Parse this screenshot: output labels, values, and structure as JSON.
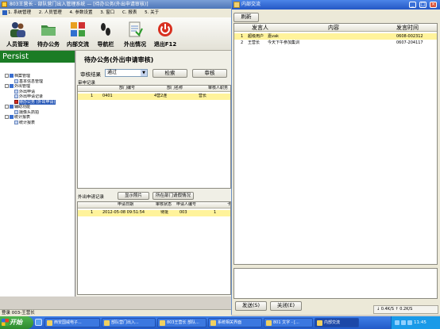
{
  "app": {
    "title": "803王营长 - 部队营门出入管理系统 — [待办公务(外出申请审核)]",
    "menu": [
      "1. 系统管理",
      "2. 人员管理",
      "4. 参数设置",
      "3. 窗口",
      "C. 报表",
      "5. 关于"
    ]
  },
  "toolbar": [
    {
      "label": "人员管理",
      "icon": "people-icon"
    },
    {
      "label": "待办公务",
      "icon": "folder-icon"
    },
    {
      "label": "内部交流",
      "icon": "apps-icon"
    },
    {
      "label": "导航栏",
      "icon": "footprints-icon"
    },
    {
      "label": "外出情况",
      "icon": "document-icon"
    },
    {
      "label": "退出F12",
      "icon": "power-icon"
    }
  ],
  "sidebar": {
    "brand": "Persist",
    "tree": [
      {
        "label": "档案管理",
        "level": 0,
        "icon": "folder"
      },
      {
        "label": "基本信息管理",
        "level": 1,
        "icon": "page"
      },
      {
        "label": "外出管理",
        "level": 0,
        "icon": "folder"
      },
      {
        "label": "外出申请",
        "level": 1,
        "icon": "page"
      },
      {
        "label": "外出申请记录",
        "level": 1,
        "icon": "page"
      },
      {
        "label": "待办公务 (外出申请)",
        "level": 1,
        "icon": "check",
        "selected": true
      },
      {
        "label": "辅助功能",
        "level": 0,
        "icon": "folder"
      },
      {
        "label": "摄像头抓拍",
        "level": 1,
        "icon": "page"
      },
      {
        "label": "统计报表",
        "level": 0,
        "icon": "folder"
      },
      {
        "label": "统计报表",
        "level": 1,
        "icon": "page"
      }
    ]
  },
  "main": {
    "title": "待办公务(外出申请审核)",
    "filter_label": "审核结果",
    "filter_value": "通过",
    "search_btn": "检索",
    "approve_btn": "审核",
    "section1": "审申记录",
    "grid1_headers": [
      "部门编号",
      "部门名称",
      "审核人职务"
    ],
    "grid1_rows": [
      {
        "idx": "1",
        "dept_no": "0401",
        "dept_name": "4营2连",
        "role": "营长"
      }
    ],
    "section2": "外出申请记录",
    "photo_btn": "显示照片",
    "dept_btn": "所在部门请假情况",
    "grid2_headers": [
      "申请日期",
      "审核状态",
      "申请人编号",
      "卡"
    ],
    "grid2_rows": [
      {
        "idx": "1",
        "date": "2012-05-08 09:51:54",
        "status": "待批",
        "applicant": "003",
        "card": "1"
      }
    ]
  },
  "status": "登录 003-王营长",
  "chat": {
    "title": "内部交流",
    "refresh_btn": "刷新",
    "headers": [
      "发言人",
      "内容",
      "发言时间"
    ],
    "rows": [
      {
        "idx": "1",
        "speaker": "超级用户",
        "content": "嘉vak",
        "time": "0608-002312"
      },
      {
        "idx": "2",
        "speaker": "王营长",
        "content": "今天下午参加集训",
        "time": "0607-204117"
      }
    ],
    "send_btn": "发送(S)",
    "close_btn": "关闭(E)",
    "speed": "↓ 0.4K/S  ↑ 0.2K/S"
  },
  "taskbar": {
    "start": "开始",
    "tasks": [
      "西安国威电子...",
      "部队营门出入...",
      "803王营长 部队...",
      "系统相关界面",
      "801 文字 - [...",
      "内部交流"
    ],
    "clock": "11:45"
  }
}
